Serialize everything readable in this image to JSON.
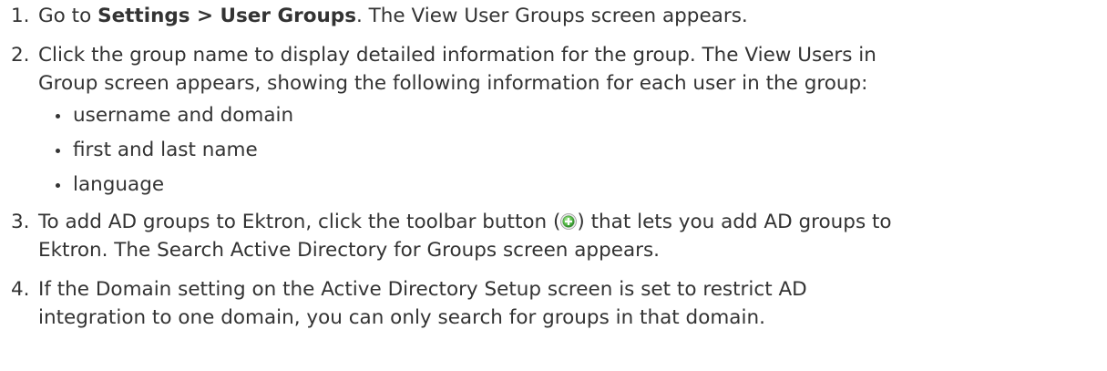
{
  "steps": [
    {
      "number": "1.",
      "pre": "Go to ",
      "bold": "Settings > User Groups",
      "post": ". The View User Groups screen appears."
    },
    {
      "number": "2.",
      "line1": "Click the group name to display detailed information for the group. The View Users in",
      "line2": "Group screen appears, showing the following information for each user in the group:",
      "bullets": [
        "username and domain",
        "first and last name",
        "language"
      ]
    },
    {
      "number": "3.",
      "pre": "To add AD groups to Ektron, click the toolbar button (",
      "icon": "add-green-plus-icon",
      "post": ") that lets you add AD groups to",
      "line2": "Ektron. The Search Active Directory for Groups screen appears."
    },
    {
      "number": "4.",
      "line1": "If the Domain setting on the Active Directory Setup screen is set to restrict AD",
      "line2": "integration to one domain, you can only search for groups in that domain."
    }
  ],
  "colors": {
    "text": "#333333",
    "icon_green": "#4caf50"
  }
}
